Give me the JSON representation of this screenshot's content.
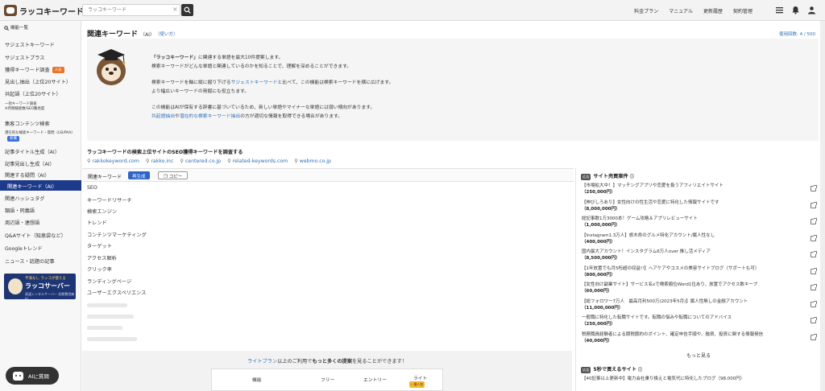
{
  "header": {
    "logo_text": "ラッコキーワード",
    "search_placeholder": "ラッコキーワード",
    "search_clear": "×",
    "nav": [
      "料金プラン",
      "マニュアル",
      "更新履歴",
      "契約管理"
    ]
  },
  "sidebar": {
    "heading": "機能一覧",
    "items": [
      {
        "label": "サジェストキーワード"
      },
      {
        "label": "サジェストプラス"
      },
      {
        "label": "獲得キーワード調査",
        "badge": "人気"
      },
      {
        "label": "見出し抽出（上位20サイト）"
      },
      {
        "label": "共起語（上位20サイト）"
      },
      {
        "label": "一括キーワード調査",
        "sub": "※月間検索数/SEO難易度"
      },
      {
        "label": "集客コンテンツ検索"
      },
      {
        "label": "潜在的な検索キーワード・質問（LSI/PAA）",
        "badge": "新機"
      },
      {
        "label": "記事タイトル生成（AI）"
      },
      {
        "label": "記事見出し生成（AI）"
      },
      {
        "label": "関連する疑問（AI）"
      },
      {
        "label": "関連キーワード（AI）",
        "active": true
      },
      {
        "label": "関連ハッシュタグ"
      },
      {
        "label": "類語・同義語"
      },
      {
        "label": "周辺語・連想語"
      },
      {
        "label": "Q&Aサイト（知恵袋など）"
      },
      {
        "label": "Googleトレンド"
      },
      {
        "label": "ニュース・話題の記事"
      }
    ],
    "banner": {
      "line1": "不満なし ラッコが使える",
      "line2": "ラッコサーバー",
      "line3": "高速レンタルサーバー 初期費用無料"
    },
    "ai_button": "AIに質問"
  },
  "main": {
    "title": "関連キーワード",
    "title_suffix": "（AI）",
    "how_to": "（使い方）",
    "usage": "使用回数: 4 / 500",
    "intro": {
      "p1_a": "「ラッコキーワード」",
      "p1_b": "に関連する単語を最大10件提案します。",
      "p2": "検索キーワードがどんな単語と関連しているのかを知ることで、理解を深めることができます。",
      "p3_a": "検索キーワードを軸に縦に掘り下げる",
      "p3_link": "サジェストキーワード",
      "p3_b": "と比べて、この機能は検索キーワードを横に広げます。",
      "p4": "より幅広いキーワードの発掘にも役立ちます。",
      "p5": "この機能はAIが保有する辞書に基づいているため、新しい単語やマイナーな単語には弱い傾向があります。",
      "p6_link": "共起語抽出",
      "p6_mid": "や",
      "p6_link2": "潜在的な検索キーワード抽出",
      "p6_b": "の方が適切な情報を取得できる場合があります。"
    },
    "seo_title": "ラッコキーワードの検索上位サイトのSEO獲得キーワードを調査する",
    "seo_links": [
      "rakkokeyword.com",
      "rakko.inc",
      "centered.co.jp",
      "related-keywords.com",
      "webmo.co.jp"
    ],
    "kw_label": "関連キーワード",
    "regen_label": "再生成",
    "copy_label": "コピー",
    "keywords": [
      "SEO",
      "キーワードリサーチ",
      "検索エンジン",
      "トレンド",
      "コンテンツマーケティング",
      "ターゲット",
      "アクセス解析",
      "クリック率",
      "ランディングページ",
      "ユーザーエクスペリエンス"
    ],
    "upsell": {
      "link": "ライトプラン",
      "text_a": "以上のご利用で",
      "bold": "もっと多くの提案",
      "text_b": "を見ることができます！",
      "cols": [
        "機能",
        "フリー",
        "エントリー",
        "ライト"
      ],
      "tag": "一番人気"
    }
  },
  "right_panel": {
    "ad_tag": "広告",
    "title": "サイト売買案件",
    "items": [
      {
        "title": "【市場拡大中！】マッチングアプリや恋愛を扱うアフィリエイトサイト",
        "price": "（250,000円）"
      },
      {
        "title": "【伸びしろあり】女性向けの性生活や恋愛に特化した情報サイトです",
        "price": "（8,000,000円）"
      },
      {
        "title": "総記事数1万3000本！ゲーム攻略＆アプリレビューサイト",
        "price": "（1,000,000円）"
      },
      {
        "title": "【Instagram1.3万人】栃木県のグルメ特化アカウント/属人性なし",
        "price": "（400,000円）"
      },
      {
        "title": "国内最大アカウント！インスタグラム6万人over 推し活メディア",
        "price": "（8,500,000円）"
      },
      {
        "title": "【1年放置でも月5桁超の収益!!】ヘアケアやコスメの美容サイトブログ（サポートも可）",
        "price": "（800,000円）"
      },
      {
        "title": "【女性向け副業サイト】サービス名xで検索順位Word1位あり、放置でアクセス数キープ",
        "price": "（60,000円）"
      },
      {
        "title": "【総フォロワー7万人　最高月利500万(2023年5月)】属人性無しの金融アカウント",
        "price": "（11,000,000円）"
      },
      {
        "title": "一般職に特化した転職サイトです。転職の悩みや転職についてのアドバイス",
        "price": "（250,000円）"
      },
      {
        "title": "税務職員経験者による節税節約のポイント、確定申告手順や、融資、投資に関する情報発信",
        "price": "（40,000円）"
      }
    ],
    "more": "もっと見る",
    "section2_title": "5秒で買えるサイト",
    "s2_items": [
      "【40記事以上更新中】電力会社乗り換えと電気代に特化したブログ（98,000円）"
    ]
  }
}
